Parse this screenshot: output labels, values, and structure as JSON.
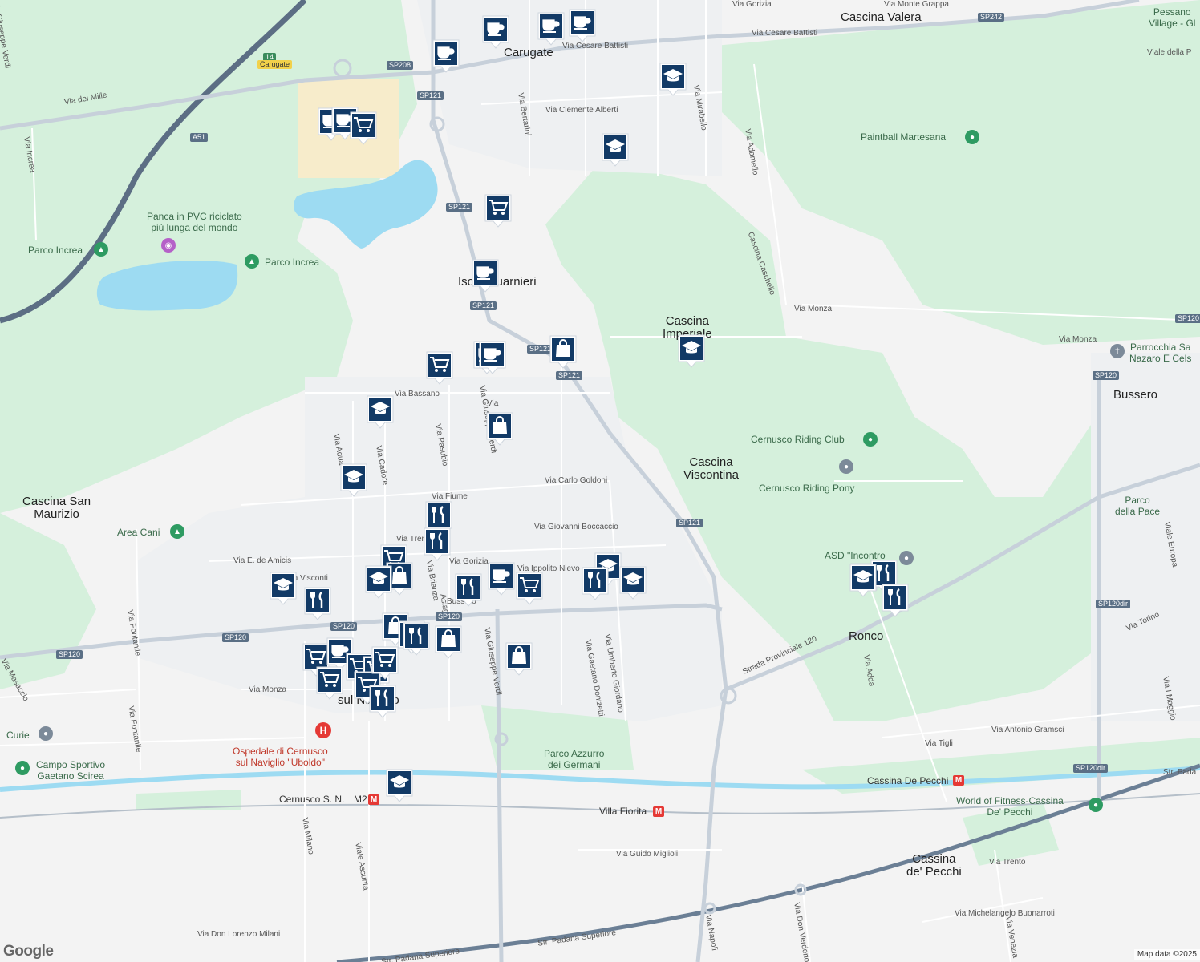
{
  "colors": {
    "park": "#d6f2dd",
    "water": "#9ed8f0",
    "road": "#ffffff",
    "major": "#c9d2db",
    "highway": "#5c6e84",
    "marker": "#123a66"
  },
  "places": [
    {
      "text": "Carugate",
      "cls": "place"
    },
    {
      "text": "Cascina Valera",
      "cls": "place"
    },
    {
      "text": "Cascina\nImperiale",
      "cls": "place"
    },
    {
      "text": "Cascina\nViscontina",
      "cls": "place"
    },
    {
      "text": "Cascina San\nMaurizio",
      "cls": "place"
    },
    {
      "text": "Bussero",
      "cls": "place"
    },
    {
      "text": "Ronco",
      "cls": "place"
    },
    {
      "text": "Cassina\nde' Pecchi",
      "cls": "place"
    },
    {
      "text": "Isola Guarnieri",
      "cls": "place"
    },
    {
      "text": "sul Naviglio",
      "cls": "place"
    },
    {
      "text": "Pessano\nVillage - Gl",
      "cls": "poi"
    },
    {
      "text": "Paintball Martesana",
      "cls": "poi"
    },
    {
      "text": "Panca in PVC riciclato\npiù lunga del mondo",
      "cls": "poi"
    },
    {
      "text": "Parco Increa",
      "cls": "poi"
    },
    {
      "text": "Parco Increa",
      "cls": "poi"
    },
    {
      "text": "Parrocchia Sa\nNazaro E Cels",
      "cls": "poi"
    },
    {
      "text": "Cernusco Riding Club",
      "cls": "poi"
    },
    {
      "text": "Cernusco Riding Pony",
      "cls": "poi"
    },
    {
      "text": "Parco\ndella Pace",
      "cls": "poi"
    },
    {
      "text": "Area Cani",
      "cls": "poi"
    },
    {
      "text": "ASD \"Incontro\na",
      "cls": "poi"
    },
    {
      "text": "Curie",
      "cls": "poi"
    },
    {
      "text": "Campo Sportivo\nGaetano Scirea",
      "cls": "poi"
    },
    {
      "text": "Ospedale di Cernusco\nsul Naviglio \"Uboldo\"",
      "cls": "poi red"
    },
    {
      "text": "Parco Azzurro\ndei Germani",
      "cls": "poi"
    },
    {
      "text": "World of Fitness-Cassina\nDe' Pecchi",
      "cls": "poi"
    },
    {
      "text": "Cernusco S. N.",
      "cls": "metro"
    },
    {
      "text": "M2",
      "cls": "metro"
    },
    {
      "text": "Cassina De Pecchi",
      "cls": "metro"
    },
    {
      "text": "Villa Fiorita",
      "cls": "metro"
    },
    {
      "text": "Via Monte Grappa",
      "cls": "road"
    },
    {
      "text": "Via Cesare Battisti",
      "cls": "road"
    },
    {
      "text": "Via Cesare Battisti",
      "cls": "road"
    },
    {
      "text": "Via dei Mille",
      "cls": "road"
    },
    {
      "text": "Via Clemente Alberti",
      "cls": "road"
    },
    {
      "text": "Via Bertarini",
      "cls": "road"
    },
    {
      "text": "Via Mirabello",
      "cls": "road"
    },
    {
      "text": "Via Adamello",
      "cls": "road"
    },
    {
      "text": "Cascina Caschello",
      "cls": "road"
    },
    {
      "text": "Via Monza",
      "cls": "road"
    },
    {
      "text": "Via Monza",
      "cls": "road"
    },
    {
      "text": "Via Monza",
      "cls": "road"
    },
    {
      "text": "Via Increa",
      "cls": "road"
    },
    {
      "text": "Via Bassano",
      "cls": "road"
    },
    {
      "text": "Via Pasubio",
      "cls": "road"
    },
    {
      "text": "Via Cadore",
      "cls": "road"
    },
    {
      "text": "Via Adua",
      "cls": "road"
    },
    {
      "text": "Via Carlo Goldoni",
      "cls": "road"
    },
    {
      "text": "Via Fiume",
      "cls": "road"
    },
    {
      "text": "Via Giovanni Boccaccio",
      "cls": "road"
    },
    {
      "text": "Via Trento",
      "cls": "road"
    },
    {
      "text": "Via E. de Amicis",
      "cls": "road"
    },
    {
      "text": "Via Visconti",
      "cls": "road"
    },
    {
      "text": "Via Gorizia",
      "cls": "road"
    },
    {
      "text": "Via Ippolito Nievo",
      "cls": "road"
    },
    {
      "text": "Via Brianza",
      "cls": "road"
    },
    {
      "text": "Via Giuseppe Verdi",
      "cls": "road"
    },
    {
      "text": "Via Giuseppe Verdi",
      "cls": "road"
    },
    {
      "text": "Via Gaetano Donizetti",
      "cls": "road"
    },
    {
      "text": "Via Umberto Giordano",
      "cls": "road"
    },
    {
      "text": "Via Fontanile",
      "cls": "road"
    },
    {
      "text": "Via Fontanile",
      "cls": "road"
    },
    {
      "text": "Via Masaccio",
      "cls": "road"
    },
    {
      "text": "Strada Provinciale 120",
      "cls": "road"
    },
    {
      "text": "Via Adda",
      "cls": "road"
    },
    {
      "text": "Via Tigli",
      "cls": "road"
    },
    {
      "text": "Via Antonio Gramsci",
      "cls": "road"
    },
    {
      "text": "Via Torino",
      "cls": "road"
    },
    {
      "text": "Viale Europa",
      "cls": "road"
    },
    {
      "text": "Viale della P",
      "cls": "road"
    },
    {
      "text": "Via Milano",
      "cls": "road"
    },
    {
      "text": "Viale Assunta",
      "cls": "road"
    },
    {
      "text": "Via Don Lorenzo Milani",
      "cls": "road"
    },
    {
      "text": "Via Guido Miglioli",
      "cls": "road"
    },
    {
      "text": "Str. Padana Superiore",
      "cls": "road"
    },
    {
      "text": "Str. Padana Superiore",
      "cls": "road"
    },
    {
      "text": "Str. Pada",
      "cls": "road"
    },
    {
      "text": "Via Don Verderio",
      "cls": "road"
    },
    {
      "text": "Via Michelangelo Buonarroti",
      "cls": "road"
    },
    {
      "text": "Via Trento",
      "cls": "road"
    },
    {
      "text": "Via Venezia",
      "cls": "road"
    },
    {
      "text": "Via Napoli",
      "cls": "road"
    },
    {
      "text": "Via I Maggio",
      "cls": "road"
    },
    {
      "text": "Bussero",
      "cls": "road"
    },
    {
      "text": "Via Gorizia",
      "cls": "road"
    },
    {
      "text": "Asiago",
      "cls": "road"
    },
    {
      "text": "Via",
      "cls": "road"
    },
    {
      "text": "Via Giuseppe Verdi",
      "cls": "road"
    }
  ],
  "shields": [
    {
      "text": "14",
      "cls": "green"
    },
    {
      "text": "Carugate",
      "cls": "yellow"
    },
    {
      "text": "A51",
      "cls": ""
    },
    {
      "text": "SP208",
      "cls": ""
    },
    {
      "text": "SP121",
      "cls": ""
    },
    {
      "text": "SP121",
      "cls": ""
    },
    {
      "text": "SP121",
      "cls": ""
    },
    {
      "text": "SP121",
      "cls": ""
    },
    {
      "text": "SP121",
      "cls": ""
    },
    {
      "text": "SP121",
      "cls": ""
    },
    {
      "text": "SP242",
      "cls": ""
    },
    {
      "text": "SP120",
      "cls": ""
    },
    {
      "text": "SP120",
      "cls": ""
    },
    {
      "text": "SP120",
      "cls": ""
    },
    {
      "text": "SP120",
      "cls": ""
    },
    {
      "text": "SP120",
      "cls": ""
    },
    {
      "text": "SP120dir",
      "cls": ""
    },
    {
      "text": "SP120dir",
      "cls": ""
    },
    {
      "text": "SP120",
      "cls": ""
    }
  ],
  "markers": [
    {
      "kind": "cafe"
    },
    {
      "kind": "cafe"
    },
    {
      "kind": "cafe"
    },
    {
      "kind": "cafe"
    },
    {
      "kind": "school"
    },
    {
      "kind": "cafe"
    },
    {
      "kind": "cafe"
    },
    {
      "kind": "grocery"
    },
    {
      "kind": "school"
    },
    {
      "kind": "grocery"
    },
    {
      "kind": "cafe"
    },
    {
      "kind": "grocery"
    },
    {
      "kind": "cafe"
    },
    {
      "kind": "cafe"
    },
    {
      "kind": "shop"
    },
    {
      "kind": "school"
    },
    {
      "kind": "school"
    },
    {
      "kind": "shop"
    },
    {
      "kind": "school"
    },
    {
      "kind": "restaurant"
    },
    {
      "kind": "restaurant"
    },
    {
      "kind": "grocery"
    },
    {
      "kind": "shop"
    },
    {
      "kind": "school"
    },
    {
      "kind": "school"
    },
    {
      "kind": "restaurant"
    },
    {
      "kind": "restaurant"
    },
    {
      "kind": "cafe"
    },
    {
      "kind": "grocery"
    },
    {
      "kind": "school"
    },
    {
      "kind": "restaurant"
    },
    {
      "kind": "school"
    },
    {
      "kind": "restaurant"
    },
    {
      "kind": "restaurant"
    },
    {
      "kind": "school"
    },
    {
      "kind": "restaurant"
    },
    {
      "kind": "restaurant"
    },
    {
      "kind": "shop"
    },
    {
      "kind": "shop"
    },
    {
      "kind": "shop"
    },
    {
      "kind": "grocery"
    },
    {
      "kind": "cafe"
    },
    {
      "kind": "grocery"
    },
    {
      "kind": "grocery"
    },
    {
      "kind": "grocery"
    },
    {
      "kind": "grocery"
    },
    {
      "kind": "restaurant"
    },
    {
      "kind": "school"
    },
    {
      "kind": "shop"
    },
    {
      "kind": "grocery"
    },
    {
      "kind": "restaurant"
    }
  ],
  "logo": "Google",
  "attribution": "Map data ©2025"
}
